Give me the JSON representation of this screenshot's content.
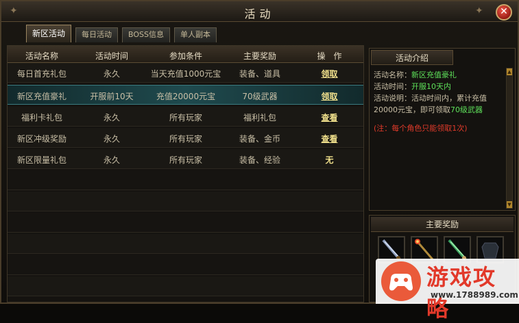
{
  "window": {
    "title": "活动"
  },
  "tabs": [
    {
      "label": "新区活动",
      "active": true
    },
    {
      "label": "每日活动",
      "active": false
    },
    {
      "label": "BOSS信息",
      "active": false
    },
    {
      "label": "单人副本",
      "active": false
    }
  ],
  "table": {
    "headers": [
      "活动名称",
      "活动时间",
      "参加条件",
      "主要奖励",
      "操　作"
    ],
    "rows": [
      {
        "name": "每日首充礼包",
        "time": "永久",
        "condition": "当天充值1000元宝",
        "reward": "装备、道具",
        "action": "领取"
      },
      {
        "name": "新区充值豪礼",
        "time": "开服前10天",
        "condition": "充值20000元宝",
        "reward": "70级武器",
        "action": "领取"
      },
      {
        "name": "福利卡礼包",
        "time": "永久",
        "condition": "所有玩家",
        "reward": "福利礼包",
        "action": "查看"
      },
      {
        "name": "新区冲级奖励",
        "time": "永久",
        "condition": "所有玩家",
        "reward": "装备、金币",
        "action": "查看"
      },
      {
        "name": "新区限量礼包",
        "time": "永久",
        "condition": "所有玩家",
        "reward": "装备、经验",
        "action": "无"
      }
    ]
  },
  "info": {
    "title": "活动介绍",
    "name_label": "活动名称：",
    "name_value": "新区充值豪礼",
    "time_label": "活动时间：",
    "time_value": "开服10天内",
    "desc_label": "活动说明：活动时间内，累计充值20000元宝，即可领取",
    "desc_value": "70级武器",
    "note": "(注：每个角色只能领取1次)"
  },
  "rewards": {
    "title": "主要奖励"
  },
  "watermark": {
    "text": "游戏攻略",
    "url": "www.1788989.com"
  }
}
